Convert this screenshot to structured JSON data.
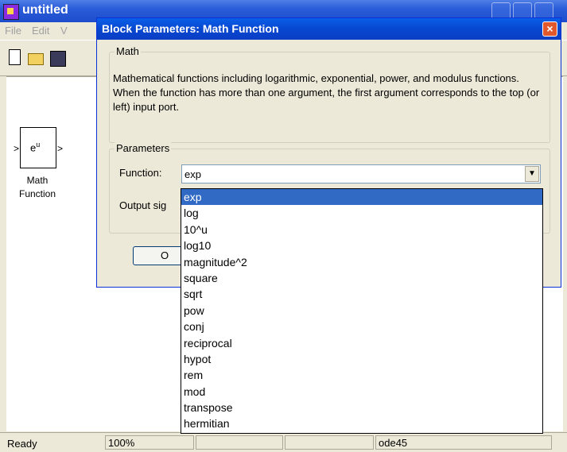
{
  "model_window": {
    "title": "untitled",
    "menu": [
      "File",
      "Edit",
      "V"
    ],
    "block": {
      "icon_label": "e",
      "icon_sup": "u",
      "caption_line1": "Math",
      "caption_line2": "Function"
    },
    "status": {
      "ready": "Ready",
      "zoom": "100%",
      "solver": "ode45"
    }
  },
  "dialog": {
    "title": "Block Parameters: Math Function",
    "close_label": "×",
    "math_group_label": "Math",
    "description": "Mathematical functions including logarithmic, exponential, power, and modulus functions.  When the function has more than one argument, the first argument corresponds to the top (or left) input port.",
    "params_group_label": "Parameters",
    "function_label": "Function:",
    "function_value": "exp",
    "output_label": "Output sig",
    "ok_label": "O"
  },
  "function_options": [
    "exp",
    "log",
    "10^u",
    "log10",
    "magnitude^2",
    "square",
    "sqrt",
    "pow",
    "conj",
    "reciprocal",
    "hypot",
    "rem",
    "mod",
    "transpose",
    "hermitian"
  ],
  "selected_option": "exp",
  "colors": {
    "title_blue": "#0a47d0",
    "selection": "#316ac5",
    "window_bg": "#ece9d8"
  }
}
